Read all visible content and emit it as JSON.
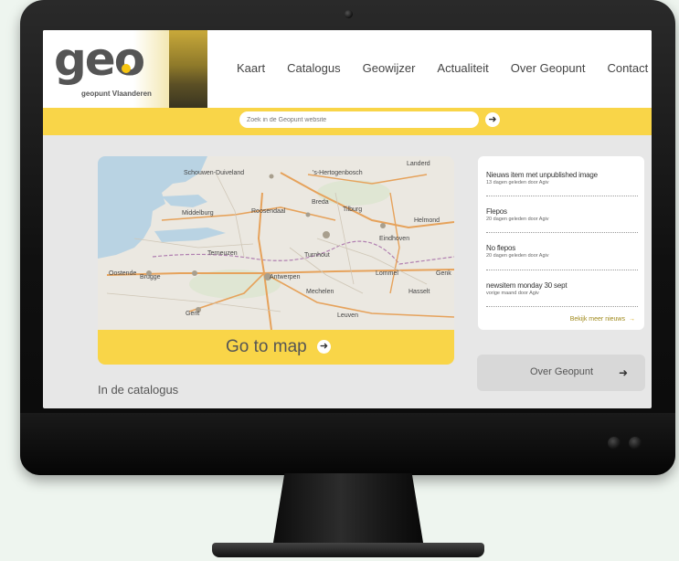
{
  "logo": {
    "wordmark": "geo",
    "subtitle": "geopunt Vlaanderen"
  },
  "nav": [
    "Kaart",
    "Catalogus",
    "Geowijzer",
    "Actualiteit",
    "Over Geopunt",
    "Contact"
  ],
  "search": {
    "placeholder": "Zoek in de Geopunt website",
    "button_icon": "arrow-right-icon"
  },
  "map": {
    "labels": [
      "'s-Hertogenbosch",
      "Schouwen-Duiveland",
      "Middelburg",
      "Roosendaal",
      "Breda",
      "Eindhoven",
      "Helmond",
      "Terneuzen",
      "Tilburg",
      "Turnhout",
      "Oostende",
      "Brugge",
      "Gent",
      "Antwerpen",
      "Lommel",
      "Mechelen",
      "Leuven",
      "Hasselt",
      "Genk",
      "Landerd"
    ]
  },
  "goto_map": {
    "label": "Go to map",
    "icon": "arrow-right-icon"
  },
  "catalogus_heading": "In de catalogus",
  "news": {
    "items": [
      {
        "title": "Nieuws item met unpublished image",
        "meta": "13 dagen geleden door Agiv"
      },
      {
        "title": "Flepos",
        "meta": "20 dagen geleden door Agiv"
      },
      {
        "title": "No flepos",
        "meta": "20 dagen geleden door Agiv"
      },
      {
        "title": "newsitem monday 30 sept",
        "meta": "vorige maand door Agiv"
      }
    ],
    "more_label": "Bekijk meer nieuws",
    "more_icon": "arrow-right-icon"
  },
  "over_button": {
    "label": "Over Geopunt",
    "icon": "arrow-right-icon"
  },
  "colors": {
    "accent": "#f9d548",
    "screen_bg": "#e7e7e7",
    "bezel": "#111111"
  }
}
